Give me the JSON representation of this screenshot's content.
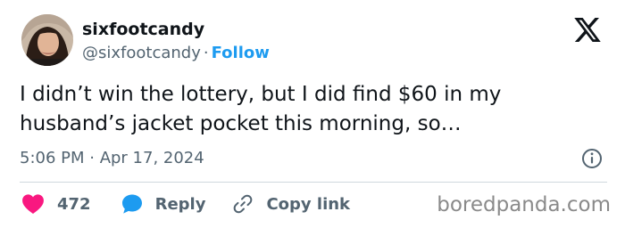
{
  "author": {
    "display_name": "sixfootcandy",
    "handle": "@sixfootcandy",
    "separator": "·",
    "follow_label": "Follow",
    "avatar_icon": "user-avatar-photo"
  },
  "tweet": {
    "text": "I didn’t win the lottery, but I did find $60 in my husband’s jacket pocket this morning, so…",
    "timestamp": "5:06 PM · Apr 17, 2024"
  },
  "icons": {
    "brand": "x-logo-icon",
    "info": "info-icon",
    "like": "heart-icon",
    "reply": "speech-bubble-icon",
    "copy": "link-icon"
  },
  "actions": {
    "like_count": "472",
    "reply_label": "Reply",
    "copy_label": "Copy link"
  },
  "watermark": "boredpanda.com",
  "colors": {
    "text": "#0f1419",
    "secondary": "#536471",
    "accent": "#1d9bf0",
    "like": "#f91880",
    "divider": "#cfd9de",
    "watermark": "#8a8a8a"
  }
}
